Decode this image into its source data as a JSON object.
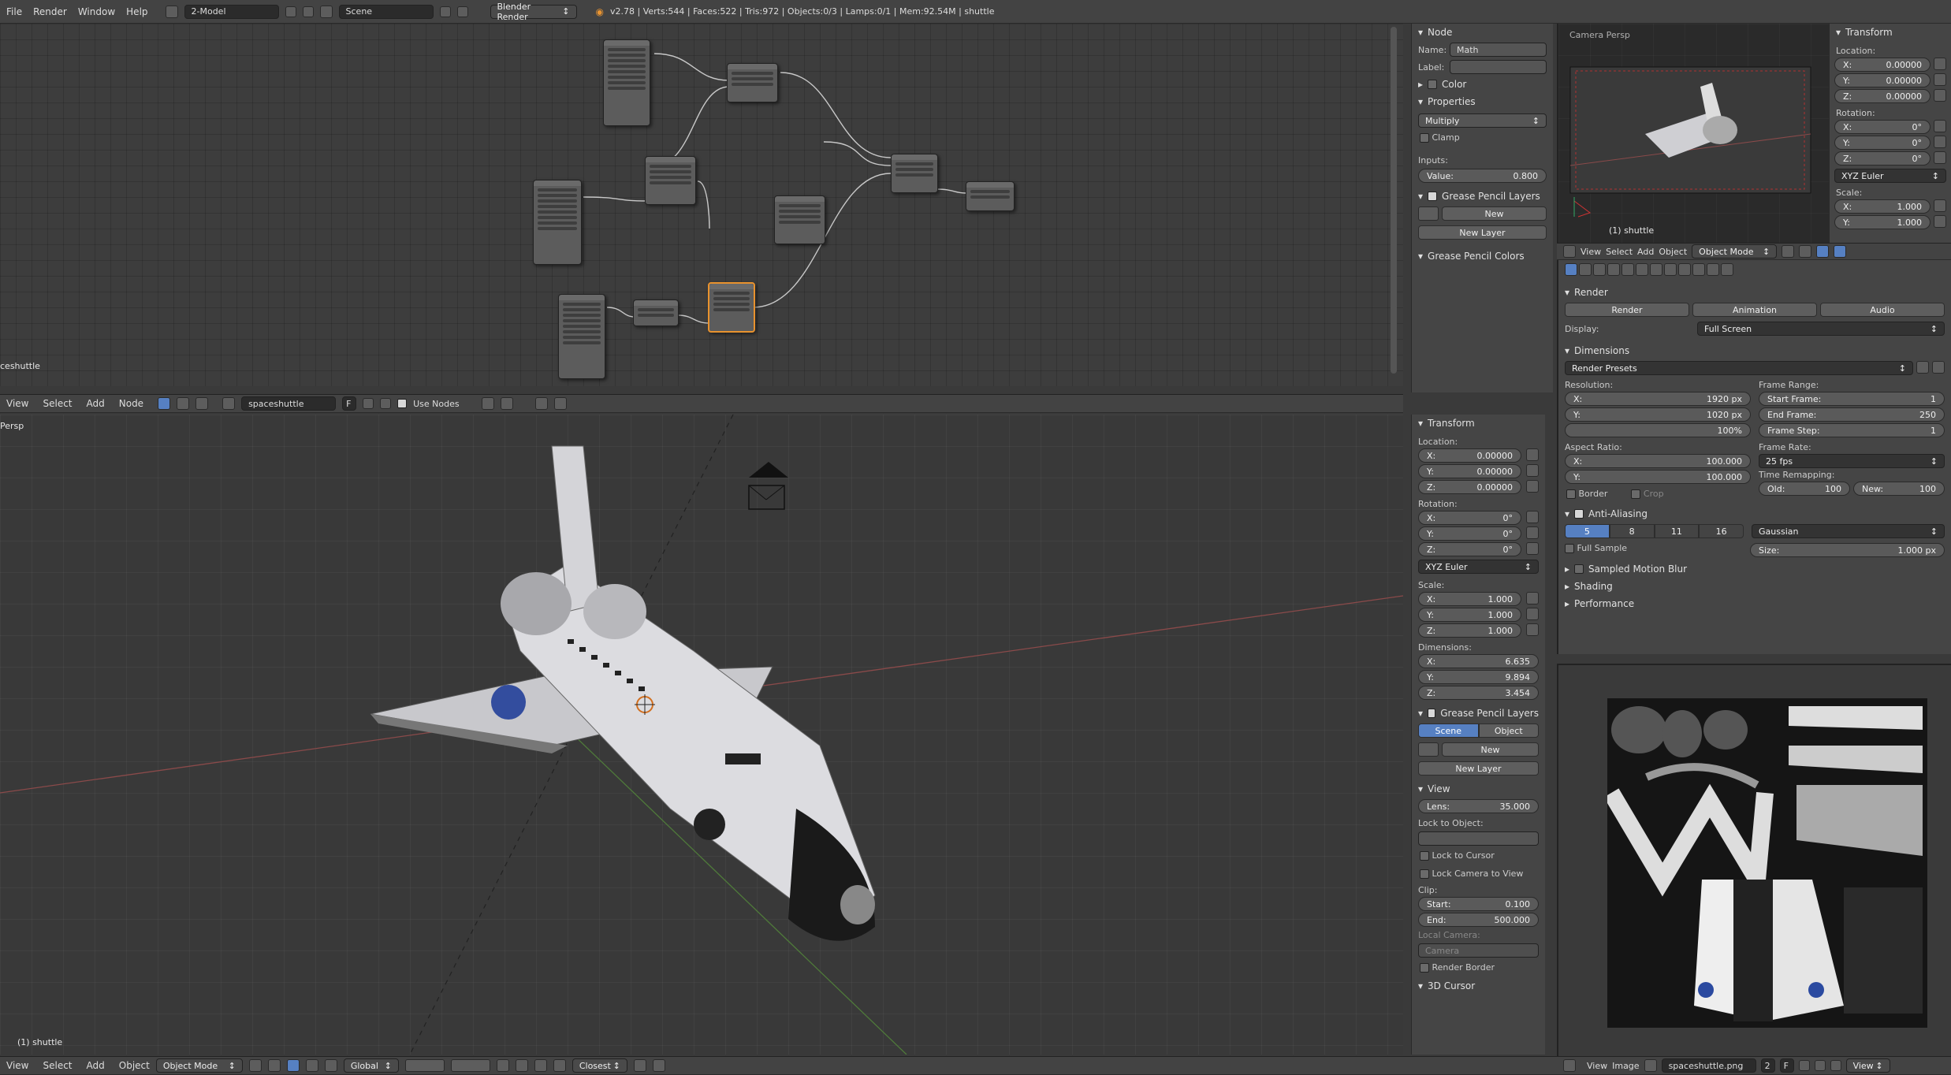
{
  "topbar": {
    "menus": [
      "File",
      "Render",
      "Window",
      "Help"
    ],
    "layout": "2-Model",
    "scene": "Scene",
    "engine": "Blender Render",
    "stats": "v2.78 | Verts:544 | Faces:522 | Tris:972 | Objects:0/3 | Lamps:0/1 | Mem:92.54M | shuttle"
  },
  "node_editor": {
    "label": "ceshuttle"
  },
  "node_panel": {
    "node_title": "Node",
    "name_label": "Name:",
    "name_value": "Math",
    "label_label": "Label:",
    "color": "Color",
    "properties": "Properties",
    "operation": "Multiply",
    "clamp": "Clamp",
    "inputs": "Inputs:",
    "value_label": "Value:",
    "value": "0.800",
    "gp_layers": "Grease Pencil Layers",
    "new": "New",
    "new_layer": "New Layer",
    "gp_colors": "Grease Pencil Colors"
  },
  "node_header": {
    "menus": [
      "View",
      "Select",
      "Add",
      "Node"
    ],
    "tree": "spaceshuttle",
    "f": "F",
    "use_nodes": "Use Nodes"
  },
  "viewport": {
    "persp": "Persp",
    "object": "(1) shuttle"
  },
  "viewport_header": {
    "menus": [
      "View",
      "Select",
      "Add",
      "Object"
    ],
    "mode": "Object Mode",
    "orientation": "Global",
    "snap": "Closest"
  },
  "n_panel": {
    "transform": "Transform",
    "location": "Location:",
    "loc": [
      "0.00000",
      "0.00000",
      "0.00000"
    ],
    "rotation": "Rotation:",
    "rot": [
      "0°",
      "0°",
      "0°"
    ],
    "euler": "XYZ Euler",
    "scale": "Scale:",
    "scl": [
      "1.000",
      "1.000",
      "1.000"
    ],
    "dimensions": "Dimensions:",
    "dim": [
      "6.635",
      "9.894",
      "3.454"
    ],
    "gp_layers": "Grease Pencil Layers",
    "scene_tab": "Scene",
    "object_tab": "Object",
    "new": "New",
    "new_layer": "New Layer",
    "view": "View",
    "lens_label": "Lens:",
    "lens": "35.000",
    "lock_obj": "Lock to Object:",
    "lock_cursor": "Lock to Cursor",
    "lock_camera": "Lock Camera to View",
    "clip": "Clip:",
    "start_label": "Start:",
    "start": "0.100",
    "end_label": "End:",
    "end": "500.000",
    "local_camera": "Local Camera:",
    "camera": "Camera",
    "render_border": "Render Border",
    "cursor3d": "3D Cursor",
    "axes": [
      "X:",
      "Y:",
      "Z:"
    ]
  },
  "camera_view": {
    "title": "Camera Persp",
    "object": "(1) shuttle"
  },
  "cam_transform": {
    "title": "Transform",
    "location": "Location:",
    "loc": [
      "0.00000",
      "0.00000",
      "0.00000"
    ],
    "rotation": "Rotation:",
    "rot": [
      "0°",
      "0°",
      "0°"
    ],
    "euler": "XYZ Euler",
    "scale": "Scale:",
    "scl": [
      "1.000",
      "1.000"
    ]
  },
  "cam_header": {
    "menus": [
      "View",
      "Select",
      "Add",
      "Object"
    ],
    "mode": "Object Mode"
  },
  "properties": {
    "render": "Render",
    "render_btn": "Render",
    "animation_btn": "Animation",
    "audio_btn": "Audio",
    "display_label": "Display:",
    "display": "Full Screen",
    "dimensions": "Dimensions",
    "presets": "Render Presets",
    "resolution": "Resolution:",
    "res_x": "1920 px",
    "res_y": "1020 px",
    "res_pct": "100%",
    "frame_range": "Frame Range:",
    "start_frame_label": "Start Frame:",
    "start_frame": "1",
    "end_frame_label": "End Frame:",
    "end_frame": "250",
    "frame_step_label": "Frame Step:",
    "frame_step": "1",
    "aspect": "Aspect Ratio:",
    "asp_x": "100.000",
    "asp_y": "100.000",
    "frame_rate": "Frame Rate:",
    "fps": "25 fps",
    "border": "Border",
    "crop": "Crop",
    "time_remap": "Time Remapping:",
    "old_label": "Old:",
    "old": "100",
    "new_label": "New:",
    "new": "100",
    "aa": "Anti-Aliasing",
    "aa_samples": [
      "5",
      "8",
      "11",
      "16"
    ],
    "filter": "Gaussian",
    "full_sample": "Full Sample",
    "size_label": "Size:",
    "size": "1.000 px",
    "motion_blur": "Sampled Motion Blur",
    "shading": "Shading",
    "performance": "Performance"
  },
  "image_header": {
    "menus": [
      "View",
      "Image"
    ],
    "image": "spaceshuttle.png",
    "users": "2",
    "f": "F",
    "view": "View"
  }
}
